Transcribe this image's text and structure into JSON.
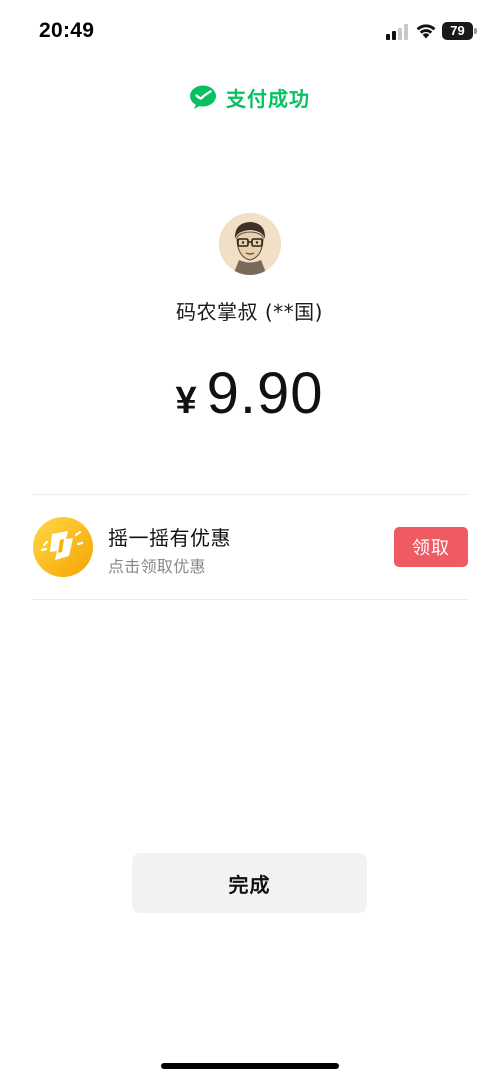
{
  "status_bar": {
    "time": "20:49",
    "battery_level": "79",
    "signal_icon": "cellular-signal-icon",
    "wifi_icon": "wifi-icon"
  },
  "header": {
    "title": "支付成功",
    "icon": "wechat-pay-icon",
    "accent_color": "#07c160"
  },
  "payee": {
    "name": "码农掌叔 (**国)",
    "avatar": "avatar-portrait"
  },
  "payment": {
    "currency_symbol": "¥",
    "amount": "9.90"
  },
  "promo": {
    "icon": "shake-coupon-icon",
    "title": "摇一摇有优惠",
    "subtitle": "点击领取优惠",
    "claim_label": "领取",
    "claim_color": "#f05a63"
  },
  "actions": {
    "done_label": "完成"
  }
}
